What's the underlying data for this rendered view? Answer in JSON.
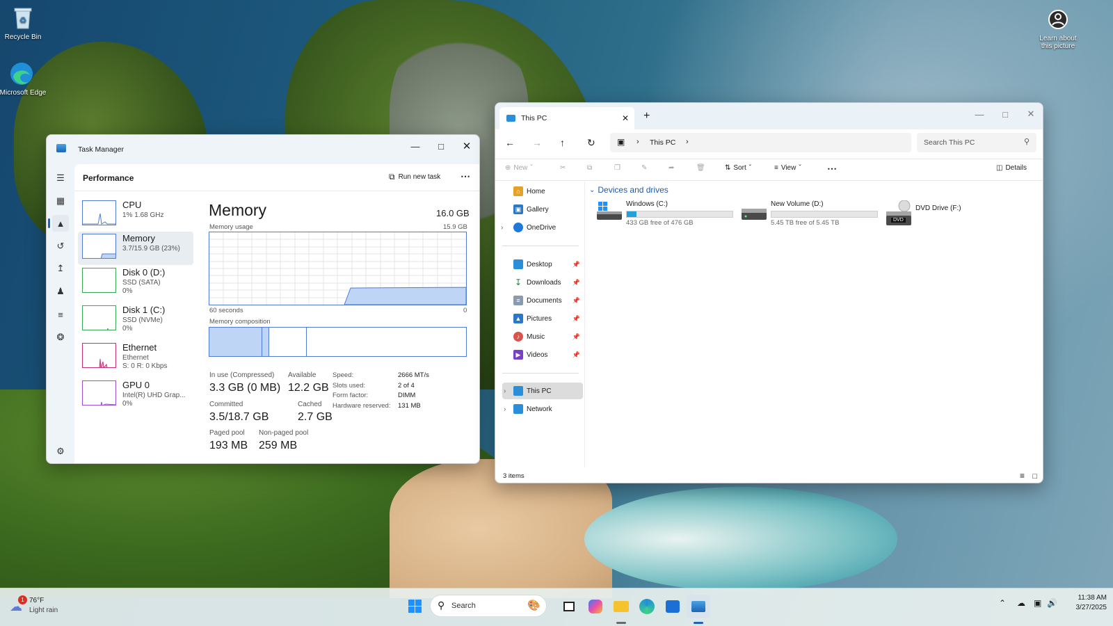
{
  "desktop": {
    "icons": [
      {
        "label": "Recycle Bin"
      },
      {
        "label": "Microsoft Edge"
      }
    ],
    "learn_about": "Learn about this picture"
  },
  "task_manager": {
    "title": "Task Manager",
    "section": "Performance",
    "run_new_task": "Run new task",
    "items": [
      {
        "title": "CPU",
        "sub1": "1% 1.68 GHz",
        "sub2": "",
        "sub3": ""
      },
      {
        "title": "Memory",
        "sub1": "3.7/15.9 GB (23%)",
        "sub2": "",
        "sub3": ""
      },
      {
        "title": "Disk 0 (D:)",
        "sub1": "SSD (SATA)",
        "sub2": "0%",
        "sub3": ""
      },
      {
        "title": "Disk 1 (C:)",
        "sub1": "SSD (NVMe)",
        "sub2": "0%",
        "sub3": ""
      },
      {
        "title": "Ethernet",
        "sub1": "Ethernet",
        "sub2": "S: 0 R: 0 Kbps",
        "sub3": ""
      },
      {
        "title": "GPU 0",
        "sub1": "Intel(R) UHD Grap...",
        "sub2": "0%",
        "sub3": ""
      }
    ],
    "memory": {
      "heading": "Memory",
      "total": "16.0 GB",
      "usage_label": "Memory usage",
      "usage_max": "15.9 GB",
      "time_left": "60 seconds",
      "time_right": "0",
      "composition_label": "Memory composition",
      "usage_fraction": 0.23,
      "in_use_label": "In use (Compressed)",
      "in_use": "3.3 GB (0 MB)",
      "available_label": "Available",
      "available": "12.2 GB",
      "committed_label": "Committed",
      "committed": "3.5/18.7 GB",
      "cached_label": "Cached",
      "cached": "2.7 GB",
      "paged_label": "Paged pool",
      "paged": "193 MB",
      "nonpaged_label": "Non-paged pool",
      "nonpaged": "259 MB",
      "speed_label": "Speed:",
      "speed": "2666 MT/s",
      "slots_label": "Slots used:",
      "slots": "2 of 4",
      "form_label": "Form factor:",
      "form": "DIMM",
      "reserved_label": "Hardware reserved:",
      "reserved": "131 MB"
    }
  },
  "explorer": {
    "tab_title": "This PC",
    "breadcrumb": "This PC",
    "search_placeholder": "Search This PC",
    "cmd": {
      "new": "New",
      "sort": "Sort",
      "view": "View",
      "details": "Details"
    },
    "nav": [
      {
        "label": "Home"
      },
      {
        "label": "Gallery"
      },
      {
        "label": "OneDrive"
      },
      {
        "label": "Desktop"
      },
      {
        "label": "Downloads"
      },
      {
        "label": "Documents"
      },
      {
        "label": "Pictures"
      },
      {
        "label": "Music"
      },
      {
        "label": "Videos"
      },
      {
        "label": "This PC"
      },
      {
        "label": "Network"
      }
    ],
    "group_title": "Devices and drives",
    "drives": [
      {
        "name": "Windows (C:)",
        "info": "433 GB free of 476 GB",
        "used_fraction": 0.09
      },
      {
        "name": "New Volume (D:)",
        "info": "5.45 TB free of 5.45 TB",
        "used_fraction": 0.0
      },
      {
        "name": "DVD Drive (F:)",
        "info": "",
        "badge": "DVD"
      }
    ],
    "status": "3 items"
  },
  "taskbar": {
    "temp": "76°F",
    "weather": "Light rain",
    "weather_badge": "1",
    "search": "Search",
    "time": "11:38 AM",
    "date": "3/27/2025"
  }
}
